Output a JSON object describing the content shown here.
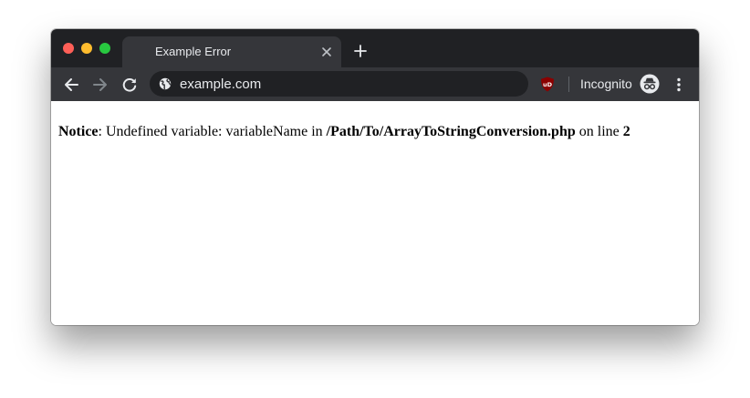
{
  "browser": {
    "tab": {
      "title": "Example Error",
      "close_icon": "close-icon"
    },
    "new_tab_icon": "plus-icon",
    "toolbar": {
      "back_icon": "arrow-left-icon",
      "forward_icon": "arrow-right-icon",
      "reload_icon": "reload-icon",
      "address": {
        "security_icon": "globe-icon",
        "url": "example.com"
      },
      "extension_icon": "ublock-origin-icon",
      "profile_label": "Incognito",
      "profile_icon": "incognito-icon",
      "menu_icon": "more-vertical-icon"
    },
    "colors": {
      "titlebar": "#202124",
      "toolbar": "#35363a",
      "omnibox": "#202124",
      "text": "#e8eaed",
      "close_light": "#fe5f57",
      "minimize_light": "#febc2e",
      "zoom_light": "#28c840",
      "extension": "#8b0000"
    }
  },
  "page": {
    "notice": {
      "label": "Notice",
      "separator": ": ",
      "message": "Undefined variable: variableName in ",
      "file": "/Path/To/ArrayToStringConversion.php",
      "line_text": " on line ",
      "line_number": "2"
    }
  }
}
